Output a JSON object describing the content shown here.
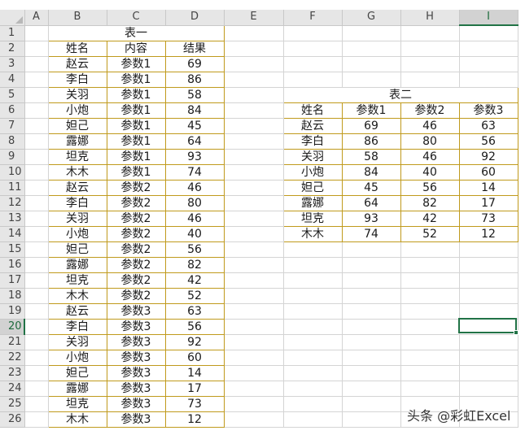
{
  "columns": [
    "A",
    "B",
    "C",
    "D",
    "E",
    "F",
    "G",
    "H",
    "I"
  ],
  "rows": [
    "1",
    "2",
    "3",
    "4",
    "5",
    "6",
    "7",
    "8",
    "9",
    "10",
    "11",
    "12",
    "13",
    "14",
    "15",
    "16",
    "17",
    "18",
    "19",
    "20",
    "21",
    "22",
    "23",
    "24",
    "25",
    "26"
  ],
  "selected_cell": {
    "column": "I",
    "row": "20"
  },
  "table1": {
    "title": "表一",
    "headers": [
      "姓名",
      "内容",
      "结果"
    ],
    "rows": [
      [
        "赵云",
        "参数1",
        "69"
      ],
      [
        "李白",
        "参数1",
        "86"
      ],
      [
        "关羽",
        "参数1",
        "58"
      ],
      [
        "小炮",
        "参数1",
        "84"
      ],
      [
        "妲己",
        "参数1",
        "45"
      ],
      [
        "露娜",
        "参数1",
        "64"
      ],
      [
        "坦克",
        "参数1",
        "93"
      ],
      [
        "木木",
        "参数1",
        "74"
      ],
      [
        "赵云",
        "参数2",
        "46"
      ],
      [
        "李白",
        "参数2",
        "80"
      ],
      [
        "关羽",
        "参数2",
        "46"
      ],
      [
        "小炮",
        "参数2",
        "40"
      ],
      [
        "妲己",
        "参数2",
        "56"
      ],
      [
        "露娜",
        "参数2",
        "82"
      ],
      [
        "坦克",
        "参数2",
        "42"
      ],
      [
        "木木",
        "参数2",
        "52"
      ],
      [
        "赵云",
        "参数3",
        "63"
      ],
      [
        "李白",
        "参数3",
        "56"
      ],
      [
        "关羽",
        "参数3",
        "92"
      ],
      [
        "小炮",
        "参数3",
        "60"
      ],
      [
        "妲己",
        "参数3",
        "14"
      ],
      [
        "露娜",
        "参数3",
        "17"
      ],
      [
        "坦克",
        "参数3",
        "73"
      ],
      [
        "木木",
        "参数3",
        "12"
      ]
    ]
  },
  "table2": {
    "title": "表二",
    "headers": [
      "姓名",
      "参数1",
      "参数2",
      "参数3"
    ],
    "rows": [
      [
        "赵云",
        "69",
        "46",
        "63"
      ],
      [
        "李白",
        "86",
        "80",
        "56"
      ],
      [
        "关羽",
        "58",
        "46",
        "92"
      ],
      [
        "小炮",
        "84",
        "40",
        "60"
      ],
      [
        "妲己",
        "45",
        "56",
        "14"
      ],
      [
        "露娜",
        "64",
        "82",
        "17"
      ],
      [
        "坦克",
        "93",
        "42",
        "73"
      ],
      [
        "木木",
        "74",
        "52",
        "12"
      ]
    ]
  },
  "watermark": "头条 @彩虹Excel",
  "colors": {
    "table_border": "#c09a1c",
    "selection": "#217346",
    "header_bg": "#e6e6e6"
  }
}
